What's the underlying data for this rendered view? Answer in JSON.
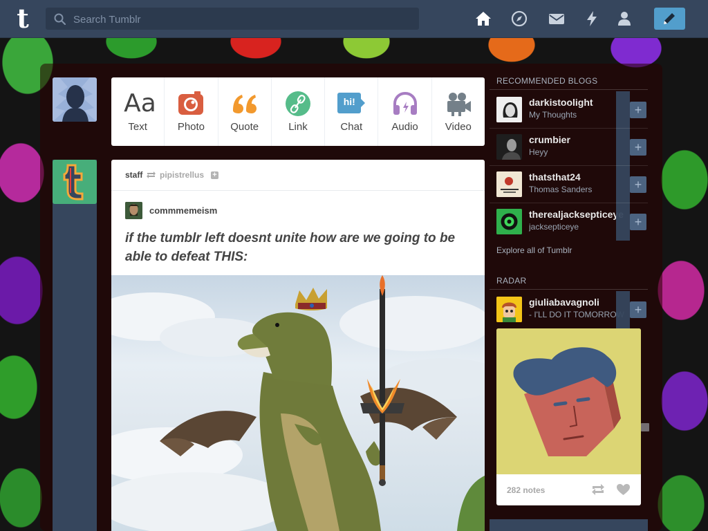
{
  "search": {
    "placeholder": "Search Tumblr"
  },
  "nav": {
    "icons": [
      "home-icon",
      "explore-compass-icon",
      "inbox-mail-icon",
      "activity-lightning-icon",
      "account-person-icon"
    ],
    "compose_icon": "pencil-icon",
    "logo_letter": "t"
  },
  "post_types": [
    {
      "label": "Text",
      "icon": "text-icon",
      "color": "#444444",
      "glyph": "Aa"
    },
    {
      "label": "Photo",
      "icon": "photo-camera-icon",
      "color": "#d95e40"
    },
    {
      "label": "Quote",
      "icon": "quote-icon",
      "color": "#f2992e"
    },
    {
      "label": "Link",
      "icon": "link-icon",
      "color": "#56bc8a"
    },
    {
      "label": "Chat",
      "icon": "chat-icon",
      "color": "#529ecc",
      "glyph": "hi!"
    },
    {
      "label": "Audio",
      "icon": "audio-headphones-icon",
      "color": "#a77dc2"
    },
    {
      "label": "Video",
      "icon": "video-camera-icon",
      "color": "#748089"
    }
  ],
  "post": {
    "author": "staff",
    "reblogged_from": "pipistrellus",
    "original_poster": "commmemeism",
    "text": "if the tumblr left doesnt unite how are we going to be able to defeat THIS:"
  },
  "sidebar": {
    "recommended_title": "RECOMMENDED BLOGS",
    "recommended": [
      {
        "name": "darkistoolight",
        "subtitle": "My Thoughts"
      },
      {
        "name": "crumbier",
        "subtitle": "Heyy"
      },
      {
        "name": "thatsthat24",
        "subtitle": "Thomas Sanders"
      },
      {
        "name": "therealjacksepticeye",
        "subtitle": "jacksepticeye"
      }
    ],
    "explore_link": "Explore all of Tumblr",
    "radar_title": "RADAR",
    "radar": {
      "name": "giuliabavagnoli",
      "subtitle": "- I'LL DO IT TOMORROW",
      "notes": "282 notes"
    }
  },
  "colors": {
    "topbar": "#36465d",
    "compose": "#529ecc",
    "staff_avatar": "#47ae7a"
  }
}
